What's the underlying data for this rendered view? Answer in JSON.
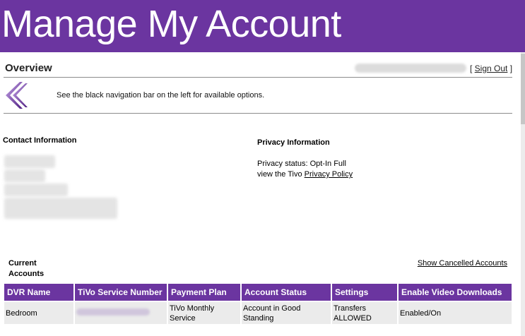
{
  "header": {
    "title": "Manage My Account"
  },
  "overview": {
    "title": "Overview",
    "signout_open": "[ ",
    "signout_label": "Sign Out",
    "signout_close": " ]",
    "nav_hint": "See the black navigation bar on the left for available options."
  },
  "contact": {
    "heading": "Contact Information"
  },
  "privacy": {
    "heading": "Privacy  Information",
    "status": "Privacy status: Opt-In Full",
    "view_prefix": "view the Tivo ",
    "policy_link": "Privacy Policy"
  },
  "accounts": {
    "heading": "Current Accounts",
    "show_cancelled": "Show Cancelled Accounts",
    "columns": [
      "DVR Name",
      "TiVo Service Number",
      "Payment Plan",
      "Account Status",
      "Settings",
      "Enable Video Downloads"
    ],
    "rows": [
      {
        "dvr_name": "Bedroom",
        "payment_plan": "TiVo Monthly Service",
        "account_status": "Account in Good Standing",
        "settings": "Transfers ALLOWED",
        "video_downloads": "Enabled/On"
      }
    ]
  },
  "colors": {
    "brand_purple": "#6b35a0"
  },
  "icons": {
    "back": "double-chevron-left-icon"
  }
}
